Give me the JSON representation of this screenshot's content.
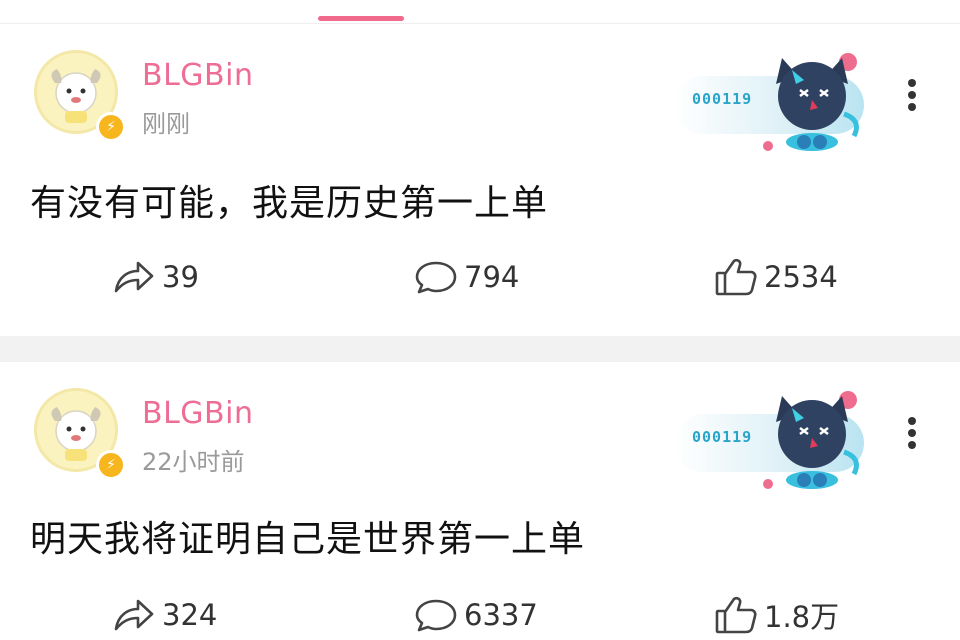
{
  "posts": [
    {
      "username": "BLGBin",
      "timestamp": "刚刚",
      "fan_card_number": "000119",
      "content": "有没有可能，我是历史第一上单",
      "shares": "39",
      "comments": "794",
      "likes": "2534"
    },
    {
      "username": "BLGBin",
      "timestamp": "22小时前",
      "fan_card_number": "000119",
      "content": "明天我将证明自己是世界第一上单",
      "shares": "324",
      "comments": "6337",
      "likes": "1.8万"
    }
  ],
  "colors": {
    "accent": "#f06a8c",
    "username": "#ee6d95",
    "badge": "#f7b61d"
  },
  "icons": {
    "share": "share-arrow-icon",
    "comment": "comment-bubble-icon",
    "like": "thumbs-up-icon",
    "more": "more-vertical-icon",
    "badge": "lightning-icon"
  }
}
